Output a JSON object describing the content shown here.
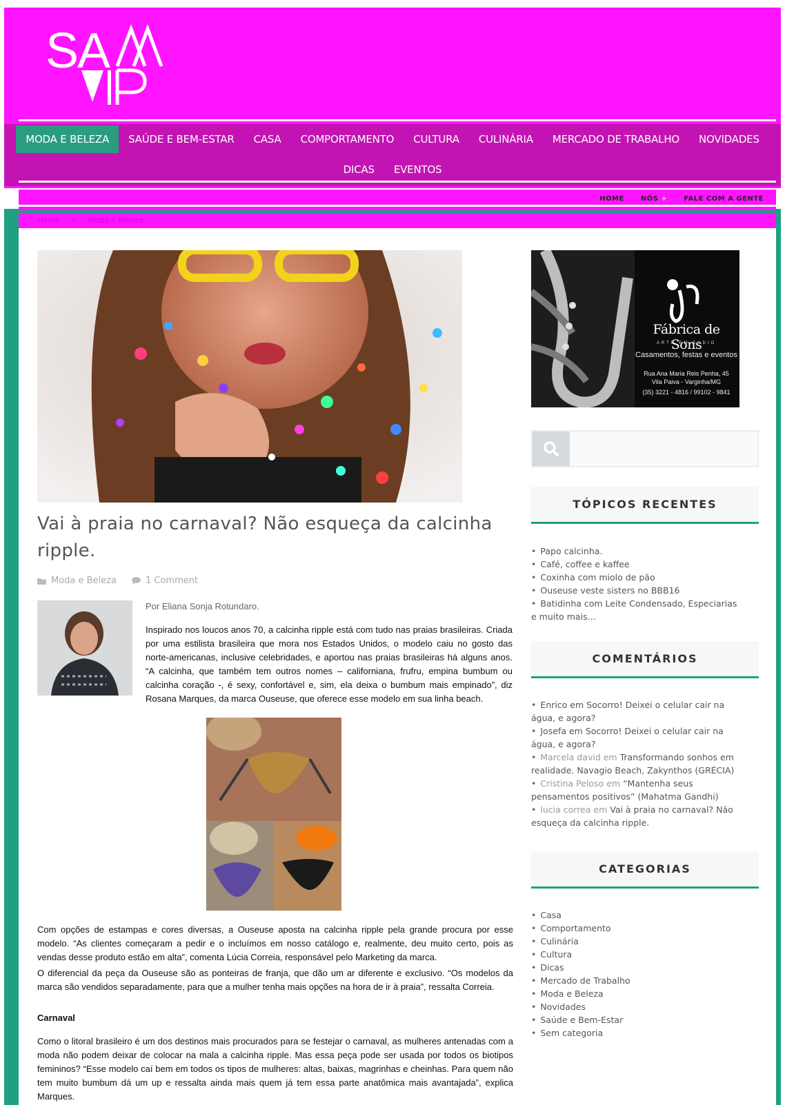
{
  "brand": {
    "logo_text": "SAIA VIP",
    "color_pink": "#ff14ff",
    "color_magenta": "#c413b3",
    "color_green": "#1fa083"
  },
  "main_nav": {
    "row1": [
      "MODA E BELEZA",
      "SAÚDE E BEM-ESTAR",
      "CASA",
      "COMPORTAMENTO",
      "CULTURA",
      "CULINÁRIA",
      "MERCADO DE TRABALHO",
      "NOVIDADES"
    ],
    "row2": [
      "DICAS",
      "EVENTOS"
    ],
    "active": "MODA E BELEZA"
  },
  "top_links": {
    "home": "HOME",
    "nos": "NÓS",
    "nos_plus": "+",
    "contact": "FALE COM A GENTE"
  },
  "breadcrumb": {
    "home": "Home",
    "separator": ">",
    "current": "Moda e Beleza"
  },
  "post": {
    "title": "Vai à praia no carnaval? Não esqueça da calcinha ripple.",
    "category": "Moda e Beleza",
    "comments": "1 Comment",
    "byline": "Por Eliana Sonja Rotundaro.",
    "p1": "Inspirado nos loucos anos 70, a calcinha ripple está com tudo nas praias brasileiras. Criada por uma estilista brasileira que mora nos Estados Unidos, o modelo caiu no gosto das norte-americanas, inclusive celebridades, e aportou nas praias brasileiras há alguns anos. “A calcinha, que também tem outros nomes – californiana, frufru, empina bumbum ou calcinha coração -, é sexy, confortável e, sim, ela deixa o bumbum mais empinado”, diz Rosana Marques, da marca Ouseuse, que oferece esse modelo em sua linha beach.",
    "p2": "Com opções de estampas e cores diversas, a Ouseuse aposta na calcinha ripple pela grande procura por esse modelo. “As clientes começaram a pedir e o incluímos em nosso catálogo e, realmente, deu muito certo, pois as vendas desse produto estão em alta”, comenta Lúcia Correia, responsável pelo Marketing da marca.",
    "p3": "O diferencial da peça da Ouseuse são as ponteiras de franja, que dão um ar diferente e exclusivo. “Os modelos da marca são vendidos separadamente, para que a mulher tenha mais opções na hora de ir à praia”, ressalta Correia.",
    "heading": "Carnaval",
    "p4": "Como o litoral brasileiro é um dos destinos mais procurados para se festejar o carnaval, as mulheres antenadas com a moda não podem deixar de colocar na mala a calcinha ripple. Mas essa peça pode ser usada por todos os biotipos femininos? “Esse modelo caí bem em todos os tipos de mulheres: altas, baixas, magrinhas e cheinhas.  Para quem não tem muito bumbum dá um up e ressalta ainda mais quem já tem essa parte anatômica mais avantajada”, explica Marques."
  },
  "ad": {
    "title": "Fábrica de Sons",
    "subtitle": "ARTE EM ÁUDIO",
    "tagline": "Casamentos, festas e eventos",
    "address1": "Rua Ana Maria Reis Penha, 45",
    "address2": "Vila Paiva - Varginha/MG",
    "phone": "(35) 3221 - 4816 / 99102 - 9841"
  },
  "search": {
    "placeholder": ""
  },
  "sidebar": {
    "recent_title": "TÓPICOS RECENTES",
    "recent": [
      "Papo calcinha.",
      "Café, coffee e kaffee",
      "Coxinha com miolo de pão",
      "Ouseuse veste sisters no BBB16",
      "Batidinha com Leite Condensado, Especiarias e muito mais…"
    ],
    "comments_title": "COMENTÁRIOS",
    "comments": [
      {
        "author": "Enrico",
        "sep": " em ",
        "post": "Socorro! Deixei o celular cair na água, e agora?"
      },
      {
        "author": "Josefa",
        "sep": " em ",
        "post": "Socorro! Deixei o celular cair na água, e agora?"
      },
      {
        "author": "Marcela david",
        "sep": " em ",
        "post": "Transformando sonhos em realidade. Navagio Beach, Zakynthos (GRÉCIA)"
      },
      {
        "author": "Cristina Peloso",
        "sep": " em ",
        "post": "“Mantenha seus pensamentos positivos” (Mahatma Gandhi)"
      },
      {
        "author": "lucia correa",
        "sep": " em ",
        "post": "Vai à praia no carnaval? Não esqueça da calcinha ripple."
      }
    ],
    "categories_title": "CATEGORIAS",
    "categories": [
      "Casa",
      "Comportamento",
      "Culinária",
      "Cultura",
      "Dicas",
      "Mercado de Trabalho",
      "Moda e Beleza",
      "Novidades",
      "Saúde e Bem-Estar",
      "Sem categoria"
    ]
  }
}
